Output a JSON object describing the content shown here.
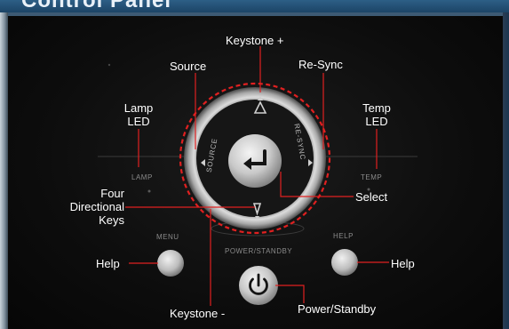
{
  "header": {
    "title": "Control Panel"
  },
  "panel_labels": {
    "lamp": "LAMP",
    "temp": "TEMP",
    "menu": "MENU",
    "help": "HELP",
    "power_standby": "POWER/STANDBY",
    "source": "SOURCE",
    "re_sync": "RE-SYNC"
  },
  "callouts": {
    "keystone_plus": "Keystone +",
    "source": "Source",
    "re_sync": "Re-Sync",
    "lamp_led_1": "Lamp",
    "lamp_led_2": "LED",
    "temp_led_1": "Temp",
    "temp_led_2": "LED",
    "four_keys_1": "Four",
    "four_keys_2": "Directional",
    "four_keys_3": "Keys",
    "select": "Select",
    "help_left": "Help",
    "help_right": "Help",
    "keystone_minus": "Keystone -",
    "power_standby": "Power/Standby"
  },
  "colors": {
    "callout_line": "#e02020",
    "dashed_ring": "#e02020",
    "header_bg": "#1f4a6e",
    "panel_bg": "#0d0d0d"
  }
}
